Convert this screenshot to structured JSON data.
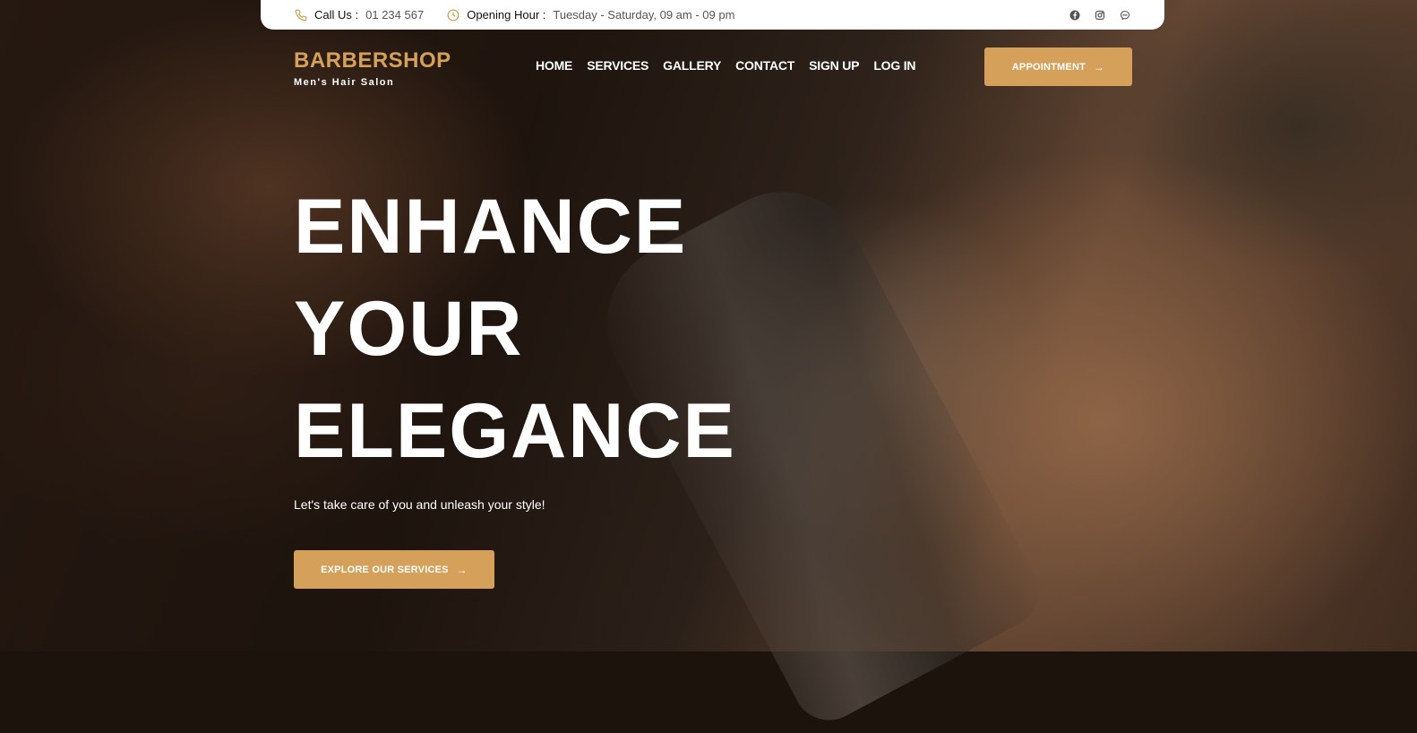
{
  "topbar": {
    "call_label": "Call Us :",
    "call_value": "01 234 567",
    "hours_label": "Opening Hour :",
    "hours_value": "Tuesday - Saturday, 09 am - 09 pm",
    "social_icons": [
      "facebook-icon",
      "instagram-icon",
      "messenger-icon"
    ]
  },
  "logo": {
    "name": "BARBERSHOP",
    "tagline": "Men's Hair Salon"
  },
  "nav": {
    "items": [
      "HOME",
      "SERVICES",
      "GALLERY",
      "CONTACT",
      "SIGN UP",
      "LOG IN"
    ]
  },
  "appointment_button": {
    "label": "APPOINTMENT"
  },
  "hero": {
    "headline_lines": [
      "ENHANCE",
      "YOUR",
      "ELEGANCE"
    ],
    "subtitle": "Let's take care of you and unleash your style!",
    "cta_label": "EXPLORE OUR SERVICES"
  },
  "colors": {
    "accent": "#d4a05a",
    "topbar_bg": "#ffffff",
    "text_light": "#ffffff"
  }
}
